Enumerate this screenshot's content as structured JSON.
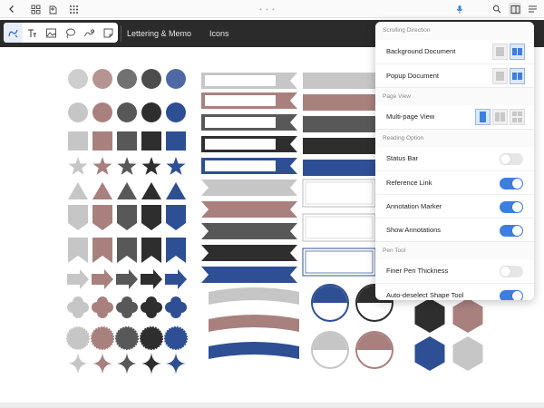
{
  "topbar": {
    "left_icons": [
      "chevron-left-icon",
      "grid-icon",
      "bookmark-icon",
      "apps-icon"
    ],
    "right_icons": [
      "microphone-icon",
      "search-icon",
      "panel-settings-icon",
      "list-menu-icon"
    ],
    "grabber": "• • •"
  },
  "toolbar": {
    "tools": [
      "pen-tool",
      "text-tool",
      "image-tool",
      "lasso-tool",
      "shape-tool",
      "sticky-note-tool"
    ],
    "tool_glyphs": [
      "✎",
      "Tт",
      "▣",
      "○",
      "∿",
      "◲"
    ],
    "tab_lettering": "Lettering & Memo",
    "tab_icons": "Icons"
  },
  "colors": {
    "gray": "#c6c6c6",
    "rose": "#a8817f",
    "dark": "#585858",
    "black": "#2e2e2e",
    "navy": "#2f4f94",
    "accent": "#3d7ee0"
  },
  "panel": {
    "sections": [
      {
        "title": "Scrolling Direction",
        "rows": [
          {
            "label": "Background Document",
            "modes": [
              "vertical-scroll",
              "horizontal-scroll"
            ],
            "selected": 1
          },
          {
            "label": "Popup Document",
            "modes": [
              "vertical-scroll",
              "horizontal-scroll"
            ],
            "selected": 1
          }
        ]
      },
      {
        "title": "Page View",
        "rows": [
          {
            "label": "Multi-page View",
            "modes": [
              "single-page",
              "two-page",
              "grid-page"
            ],
            "selected": 0
          }
        ]
      },
      {
        "title": "Reading Option",
        "rows": [
          {
            "label": "Status Bar",
            "on": false
          },
          {
            "label": "Reference Link",
            "on": true
          },
          {
            "label": "Annotation Marker",
            "on": true
          },
          {
            "label": "Show Annotations",
            "on": true
          }
        ]
      },
      {
        "title": "Pen Tool",
        "rows": [
          {
            "label": "Finer Pen Thickness",
            "on": false
          },
          {
            "label": "Auto-deselect Shape Tool",
            "on": true
          }
        ]
      }
    ]
  }
}
